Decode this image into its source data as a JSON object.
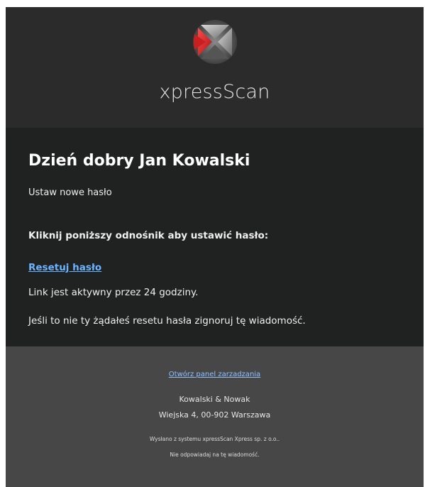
{
  "header": {
    "brand": "xpressScan",
    "logo_icon": "xpressscan-logo-icon",
    "colors": {
      "background": "#2b2b2b",
      "logo_red": "#d42b2b"
    }
  },
  "content": {
    "greeting": "Dzień dobry Jan Kowalski",
    "subtitle": "Ustaw nowe hasło",
    "instruction": "Kliknij poniższy odnośnik aby ustawić hasło:",
    "reset_link": "Resetuj hasło",
    "validity": "Link jest aktywny przez 24 godziny.",
    "ignore_note": "Jeśli to nie ty żądałeś resetu hasła zignoruj tę wiadomość.",
    "colors": {
      "background": "#202121",
      "link": "#6bb4ff"
    }
  },
  "footer": {
    "panel_link": "Otwórz panel zarzadzania",
    "company": "Kowalski & Nowak",
    "address": "Wiejska 4, 00-902 Warszawa",
    "sent_from": "Wysłano z systemu xpressScan Xpress sp. z o.o..",
    "no_reply": "Nie odpowiadaj na tę wiadomość.",
    "colors": {
      "background": "#474747",
      "link": "#8fc1ff"
    }
  }
}
